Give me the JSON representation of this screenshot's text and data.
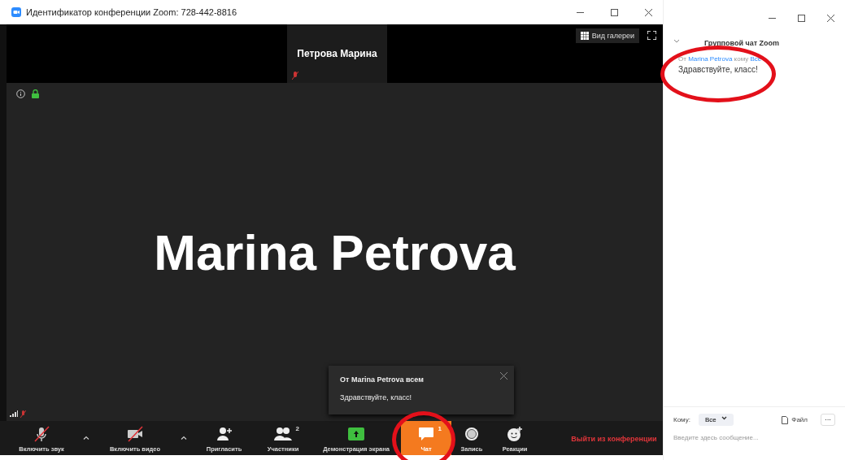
{
  "meeting_window": {
    "title": "Идентификатор конференции Zoom: 728-442-8816",
    "thumbnail": {
      "name": "Петрова Марина",
      "mic_muted": true
    },
    "gallery_button": "Вид галереи",
    "speaker_name": "Marina Petrova",
    "notification": {
      "title": "От Marina Petrova всем",
      "text": "Здравствуйте, класс!"
    },
    "toolbar": [
      {
        "kind": "mic",
        "label": "Включить звук",
        "muted": true,
        "selected": false
      },
      {
        "kind": "caret",
        "selected": false
      },
      {
        "kind": "video",
        "label": "Включить видео",
        "muted": true,
        "selected": false
      },
      {
        "kind": "caret",
        "selected": false
      },
      {
        "kind": "invite",
        "label": "Пригласить",
        "selected": false
      },
      {
        "kind": "participants",
        "label": "Участники",
        "badge": "2",
        "selected": false
      },
      {
        "kind": "share",
        "label": "Демонстрация экрана",
        "selected": false
      },
      {
        "kind": "chat",
        "label": "Чат",
        "badge": "1",
        "selected": true
      },
      {
        "kind": "record",
        "label": "Запись",
        "selected": false
      },
      {
        "kind": "reactions",
        "label": "Реакции",
        "selected": false
      },
      {
        "kind": "leave",
        "label": "Выйти из конференции",
        "selected": false
      }
    ]
  },
  "chat_window": {
    "title": "Групповой чат Zoom",
    "message": {
      "from": "От",
      "sender": "Marina Petrova",
      "to": "кому",
      "recipient": "Все",
      "text": "Здравствуйте, класс!"
    },
    "composer": {
      "to_label": "Кому:",
      "recipient": "Все",
      "file_button": "Файл",
      "more_button": "···",
      "placeholder": "Введите здесь сообщение..."
    }
  },
  "annotations": [
    {
      "kind": "ellipse"
    },
    {
      "kind": "ellipse"
    }
  ]
}
